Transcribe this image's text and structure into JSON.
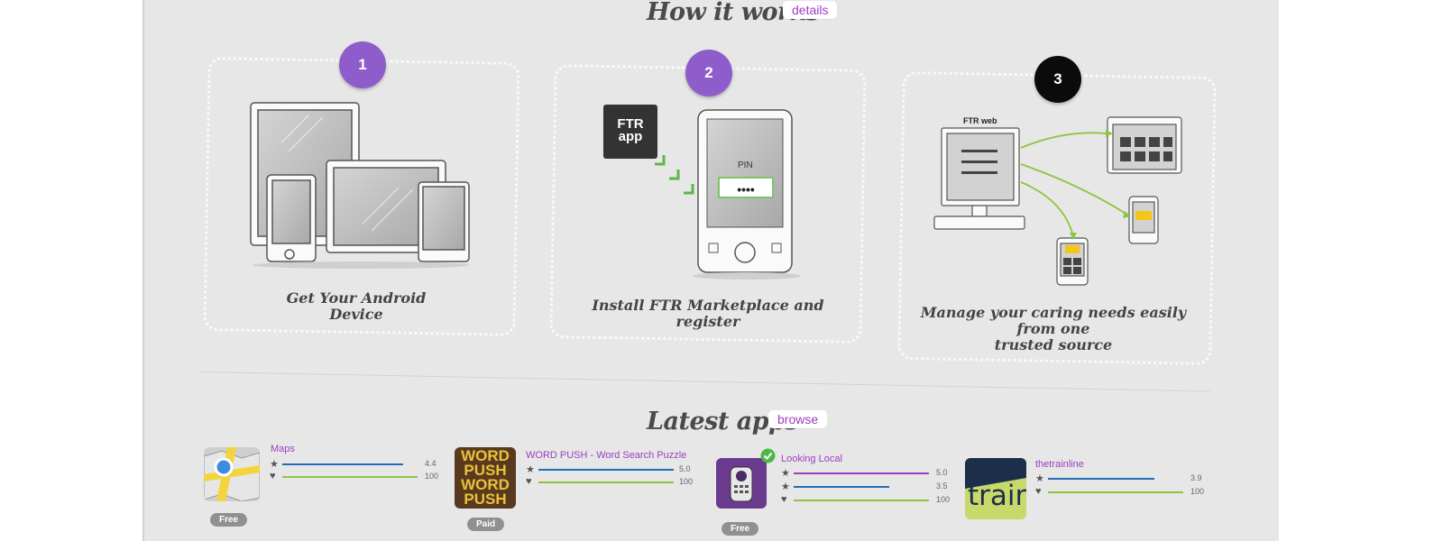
{
  "how": {
    "title": "How it works",
    "details": "details",
    "steps": [
      {
        "num": "1",
        "caption": "Get Your Android Device"
      },
      {
        "num": "2",
        "caption": "Install FTR Marketplace and register"
      },
      {
        "num": "3",
        "caption_line1": "Manage your caring needs easily from one",
        "caption_line2": "trusted source"
      }
    ],
    "ftr_app_line1": "FTR",
    "ftr_app_line2": "app",
    "pin_label": "PIN",
    "pin_value": "••••",
    "ftr_web": "FTR web"
  },
  "latest": {
    "title": "Latest apps",
    "browse": "browse",
    "apps": [
      {
        "name": "Maps",
        "price": "Free",
        "ratings": [
          "4.4",
          "100"
        ]
      },
      {
        "name": "WORD PUSH - Word Search Puzzle",
        "price": "Paid",
        "ratings": [
          "5.0",
          "100"
        ],
        "icon_text": "WORD PUSH WORD PUSH"
      },
      {
        "name": "Looking Local",
        "price": "Free",
        "ratings": [
          "5.0",
          "3.5",
          "100"
        ]
      },
      {
        "name": "thetrainline",
        "price": "",
        "ratings": [
          "3.9",
          "100"
        ],
        "icon_text": "train"
      }
    ]
  },
  "colors": {
    "accent": "#9b3fc0",
    "step_purple": "#8f5ccc",
    "green": "#8cc63f",
    "blue": "#1f6fb5"
  }
}
